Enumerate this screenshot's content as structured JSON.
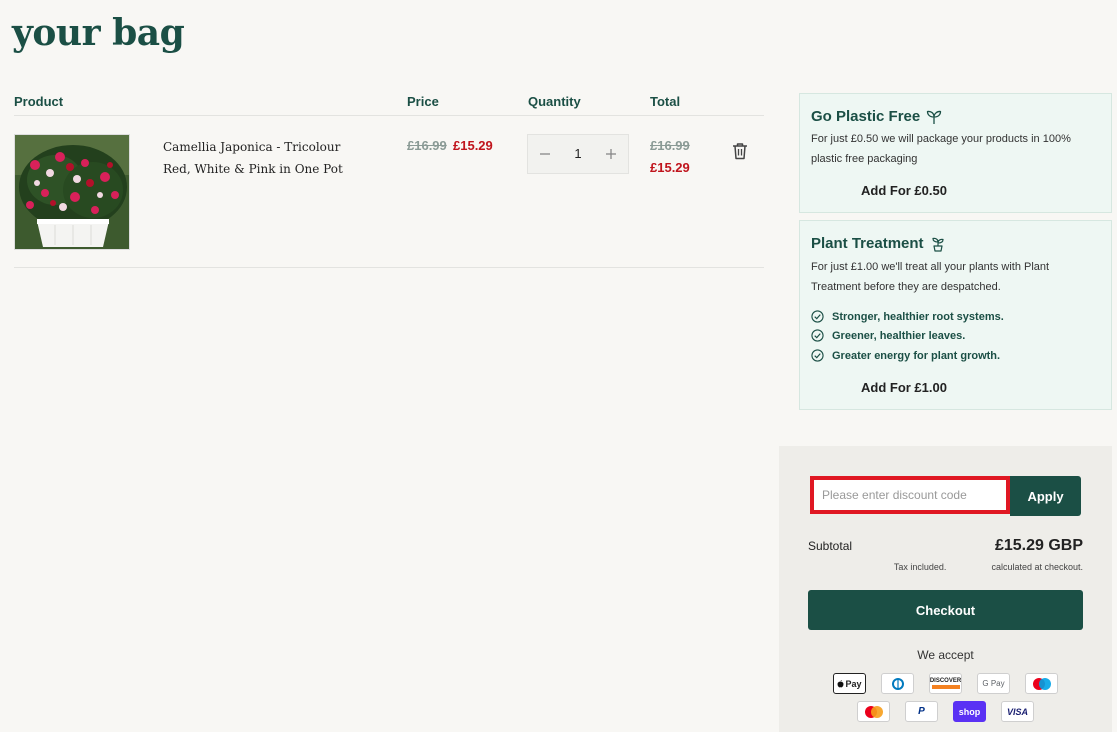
{
  "page": {
    "title": "your bag"
  },
  "cart": {
    "headers": {
      "product": "Product",
      "price": "Price",
      "quantity": "Quantity",
      "total": "Total"
    },
    "items": [
      {
        "name": "Camellia Japonica - Tricolour Red, White & Pink in One Pot",
        "price_original": "£16.99",
        "price_sale": "£15.29",
        "quantity": "1",
        "total_original": "£16.99",
        "total_sale": "£15.29"
      }
    ]
  },
  "addons": {
    "plastic_free": {
      "title": "Go Plastic Free",
      "description": "For just £0.50 we will package your products in 100% plastic free packaging",
      "button": "Add For £0.50"
    },
    "plant_treatment": {
      "title": "Plant Treatment",
      "description": "For just £1.00 we'll treat all your plants with Plant Treatment before they are despatched.",
      "benefits": [
        "Stronger, healthier root systems.",
        "Greener, healthier leaves.",
        "Greater energy for plant growth."
      ],
      "button": "Add For £1.00"
    }
  },
  "summary": {
    "discount_placeholder": "Please enter discount code",
    "apply_label": "Apply",
    "subtotal_label": "Subtotal",
    "subtotal_value": "£15.29 GBP",
    "tax_note_start": "Tax included.",
    "tax_note_end": "calculated at checkout.",
    "checkout_label": "Checkout",
    "we_accept": "We accept"
  },
  "payment_methods": [
    {
      "name": "Apple Pay",
      "label": "Pay"
    },
    {
      "name": "Diners Club",
      "label": ""
    },
    {
      "name": "Discover",
      "label": "DISCOVER"
    },
    {
      "name": "Google Pay",
      "label": "G Pay"
    },
    {
      "name": "Maestro",
      "label": ""
    },
    {
      "name": "Mastercard",
      "label": ""
    },
    {
      "name": "PayPal",
      "label": "P"
    },
    {
      "name": "Shop Pay",
      "label": "shop"
    },
    {
      "name": "Visa",
      "label": "VISA"
    }
  ],
  "colors": {
    "brand": "#1b4f45",
    "sale": "#c0141c",
    "highlight": "#e01823",
    "addon_bg": "#eef7f3"
  }
}
